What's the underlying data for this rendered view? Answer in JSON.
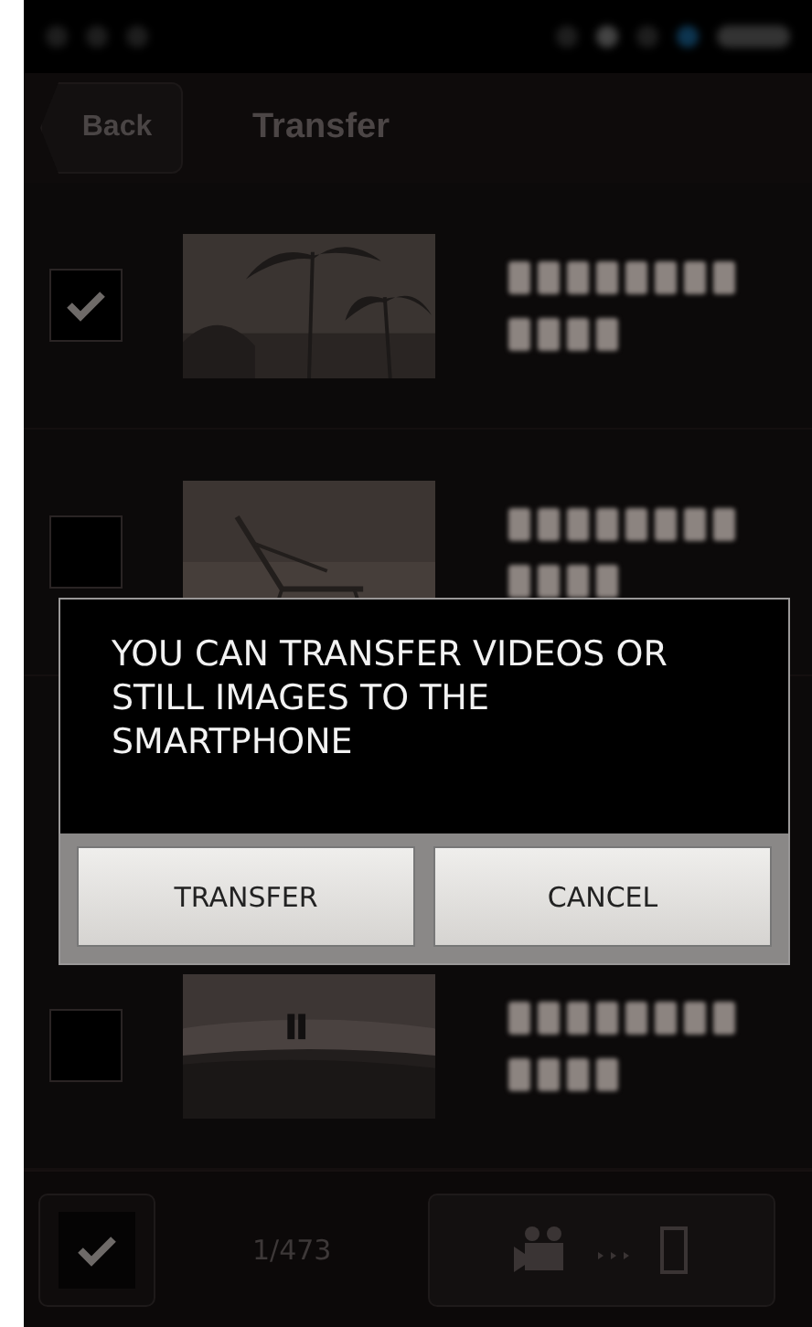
{
  "header": {
    "back": "Back",
    "title": "Transfer"
  },
  "items": [
    {
      "checked": true
    },
    {
      "checked": false
    },
    {
      "checked": false
    }
  ],
  "dialog": {
    "message": "YOU CAN TRANSFER VIDEOS OR STILL IMAGES TO THE SMARTPHONE",
    "buttons": [
      "TRANSFER",
      "CANCEL"
    ]
  },
  "footer": {
    "select_all_checked": true,
    "count": "1/473"
  }
}
